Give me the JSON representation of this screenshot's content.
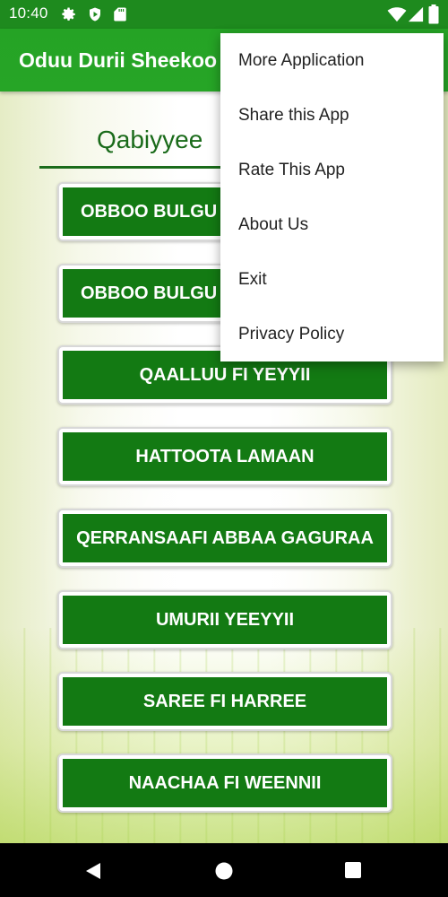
{
  "status_bar": {
    "time": "10:40",
    "icons": [
      "gear-icon",
      "play-protect-icon",
      "sd-card-icon",
      "wifi-icon",
      "signal-icon",
      "battery-icon"
    ]
  },
  "app_bar": {
    "title": "Oduu Durii Sheekoo"
  },
  "content": {
    "section_title": "Qabiyyee",
    "stories": [
      {
        "label": "OBBOO BULGU"
      },
      {
        "label": "OBBOO BULGU"
      },
      {
        "label": "QAALLUU FI YEYYII"
      },
      {
        "label": "HATTOOTA LAMAAN"
      },
      {
        "label": "QERRANSAAFI ABBAA GAGURAA"
      },
      {
        "label": "UMURII YEEYYII"
      },
      {
        "label": "SAREE FI HARREE"
      },
      {
        "label": "NAACHAA FI WEENNII"
      }
    ]
  },
  "overflow_menu": {
    "items": [
      {
        "label": "More Application"
      },
      {
        "label": "Share this App"
      },
      {
        "label": "Rate This App"
      },
      {
        "label": "About Us"
      },
      {
        "label": "Exit"
      },
      {
        "label": "Privacy Policy"
      }
    ]
  },
  "nav_bar": {
    "buttons": [
      "back-icon",
      "home-icon",
      "recents-icon"
    ]
  },
  "colors": {
    "status_bar": "#1e8a1e",
    "app_bar": "#25a325",
    "button_fill": "#137a13",
    "title_text": "#1a6b1a"
  }
}
